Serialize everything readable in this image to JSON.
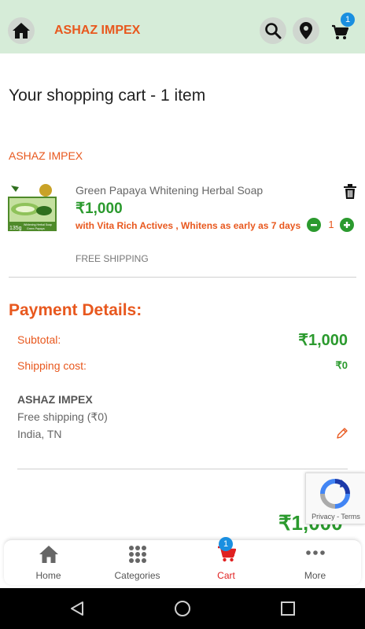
{
  "header": {
    "brand": "ASHAZ IMPEX",
    "cart_badge": "1",
    "icons": [
      "home-icon",
      "search-icon",
      "location-pin-icon",
      "cart-icon"
    ]
  },
  "cart": {
    "title": "Your shopping cart - 1 item",
    "seller": "ASHAZ IMPEX",
    "item": {
      "name": "Green Papaya Whitening Herbal Soap",
      "price": "₹1,000",
      "description": "with Vita Rich Actives , Whitens as early as 7 days",
      "shipping": "FREE SHIPPING",
      "quantity": "1",
      "image_texts": [
        "135g",
        "Whitening Herbal Soap",
        "Green Papaya"
      ]
    }
  },
  "payment": {
    "title": "Payment Details:",
    "subtotal_label": "Subtotal:",
    "subtotal_value": "₹1,000",
    "shipping_label": "Shipping cost:",
    "shipping_value": "₹0",
    "address_seller": "ASHAZ IMPEX",
    "address_shipping": "Free shipping (₹0)",
    "address_location": "India, TN",
    "total_peek": "₹1,000"
  },
  "recaptcha": {
    "text": "Privacy - Terms"
  },
  "bottom_nav": {
    "items": [
      {
        "label": "Home",
        "icon": "home-icon"
      },
      {
        "label": "Categories",
        "icon": "grid-icon"
      },
      {
        "label": "Cart",
        "icon": "cart-icon",
        "active": true
      },
      {
        "label": "More",
        "icon": "more-icon"
      }
    ],
    "cart_badge": "1"
  },
  "colors": {
    "accent_orange": "#e8581e",
    "price_green": "#2b9a2e",
    "header_bg": "#d6ecd8",
    "active_nav": "#e02020",
    "badge_blue": "#1a8fe0"
  }
}
